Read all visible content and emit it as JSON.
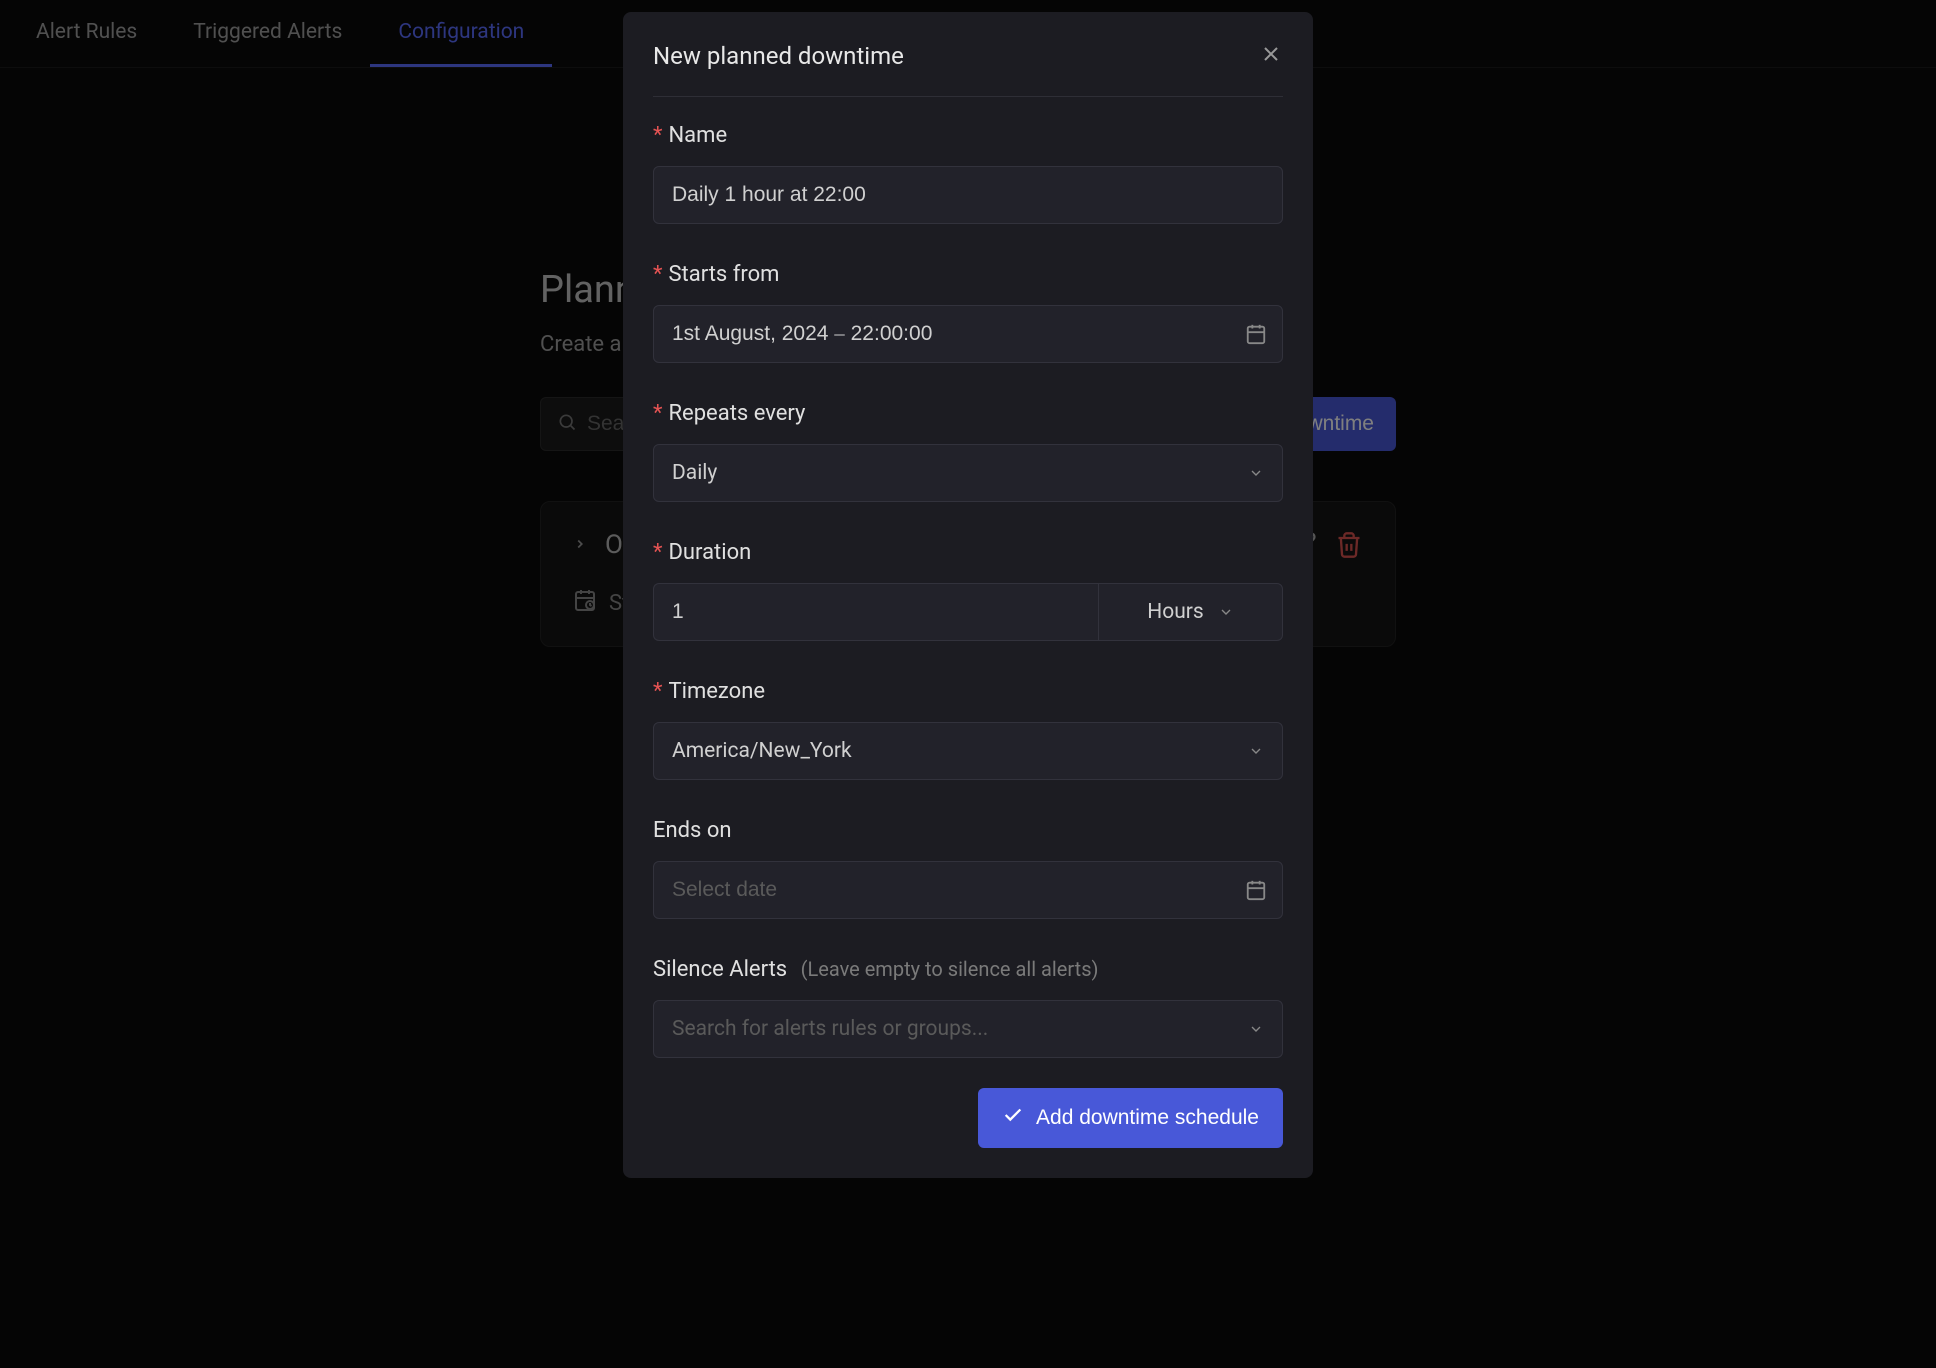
{
  "tabs": {
    "alert_rules": "Alert Rules",
    "triggered_alerts": "Triggered Alerts",
    "configuration": "Configuration"
  },
  "page": {
    "title_partial": "Planne",
    "subtitle_partial": "Create a",
    "search_placeholder": "Sea",
    "new_downtime_label": "New downtime"
  },
  "card": {
    "title_partial": "On",
    "meta_partial": "Sta"
  },
  "modal": {
    "title": "New planned downtime",
    "labels": {
      "name": "Name",
      "starts_from": "Starts from",
      "repeats_every": "Repeats every",
      "duration": "Duration",
      "timezone": "Timezone",
      "ends_on": "Ends on",
      "silence_alerts": "Silence Alerts",
      "silence_hint": "(Leave empty to silence all alerts)"
    },
    "values": {
      "name": "Daily 1 hour at 22:00",
      "starts_from": "1st August, 2024 ⎯ 22:00:00",
      "repeats_every": "Daily",
      "duration_value": "1",
      "duration_unit": "Hours",
      "timezone": "America/New_York",
      "ends_on_placeholder": "Select date",
      "silence_placeholder": "Search for alerts rules or groups..."
    },
    "submit_label": "Add downtime schedule"
  }
}
